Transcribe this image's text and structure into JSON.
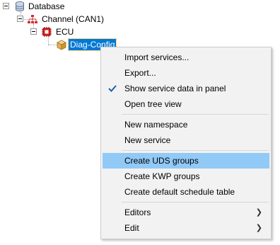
{
  "tree": {
    "database_label": "Database",
    "channel_label": "Channel (CAN1)",
    "ecu_label": "ECU",
    "diag_label": "Diag-Config"
  },
  "menu": {
    "items": [
      {
        "label": "Import services..."
      },
      {
        "label": "Export..."
      },
      {
        "label": "Show service data in panel",
        "checked": true
      },
      {
        "label": "Open tree view"
      },
      {
        "label": "New namespace"
      },
      {
        "label": "New service"
      },
      {
        "label": "Create UDS groups",
        "highlighted": true
      },
      {
        "label": "Create KWP groups"
      },
      {
        "label": "Create default schedule table"
      },
      {
        "label": "Editors",
        "submenu": true
      },
      {
        "label": "Edit",
        "submenu": true
      }
    ]
  },
  "colors": {
    "selection": "#0078d7",
    "hover": "#91c9f7",
    "menu_background": "#f2f2f2",
    "ecu_icon": "#e02020"
  },
  "icons": {
    "database": "database-icon",
    "channel": "network-icon",
    "ecu": "ecu-chip-icon",
    "diag": "package-box-icon",
    "check": "check-icon",
    "submenu": "chevron-right-icon"
  }
}
